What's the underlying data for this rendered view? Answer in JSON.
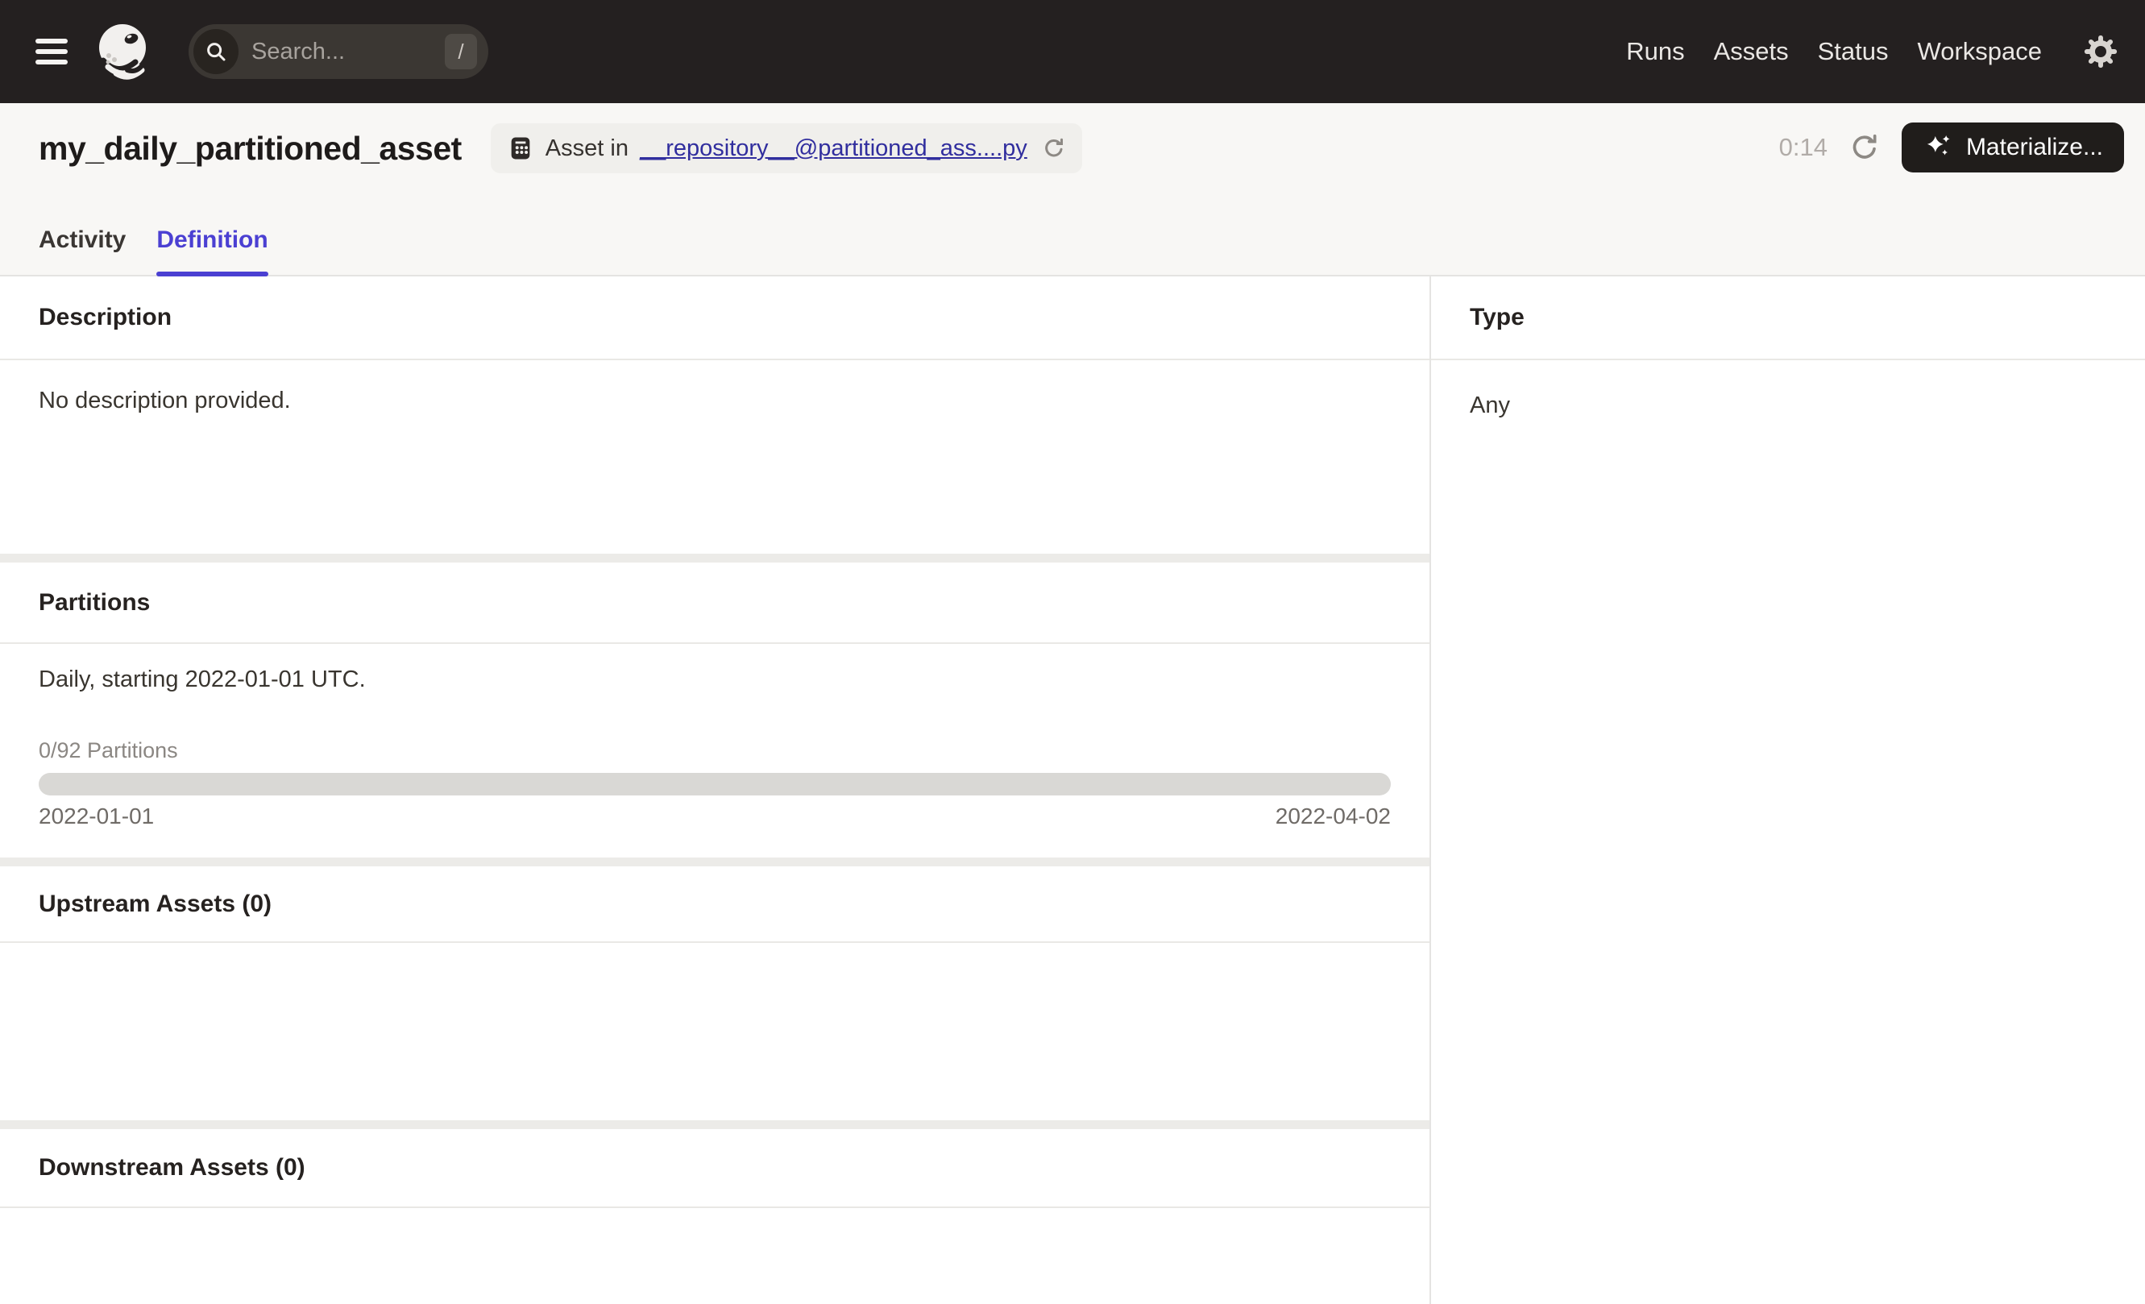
{
  "navbar": {
    "search": {
      "placeholder": "Search...",
      "shortcut_key": "/"
    },
    "links": [
      "Runs",
      "Assets",
      "Status",
      "Workspace"
    ]
  },
  "header": {
    "title": "my_daily_partitioned_asset",
    "asset_badge": {
      "prefix": "Asset in",
      "link_text": "__repository__@partitioned_ass....py"
    },
    "refresh_timer": "0:14",
    "materialize_label": "Materialize..."
  },
  "tabs": {
    "activity": "Activity",
    "definition": "Definition"
  },
  "sections": {
    "description": {
      "heading": "Description",
      "empty_text": "No description provided."
    },
    "partitions": {
      "heading": "Partitions",
      "summary": "Daily, starting 2022-01-01 UTC.",
      "progress_label": "0/92 Partitions",
      "progress_percent": 0,
      "range_start": "2022-01-01",
      "range_end": "2022-04-02"
    },
    "upstream": {
      "heading": "Upstream Assets (0)"
    },
    "downstream": {
      "heading": "Downstream Assets (0)"
    },
    "type": {
      "heading": "Type",
      "value": "Any"
    }
  },
  "colors": {
    "navbar_bg": "#242020",
    "accent": "#4B40D2",
    "link": "#312E9E",
    "materialize_bg": "#201D1B",
    "header_bg": "#F8F7F5",
    "progress_track": "#D9D8D5"
  }
}
